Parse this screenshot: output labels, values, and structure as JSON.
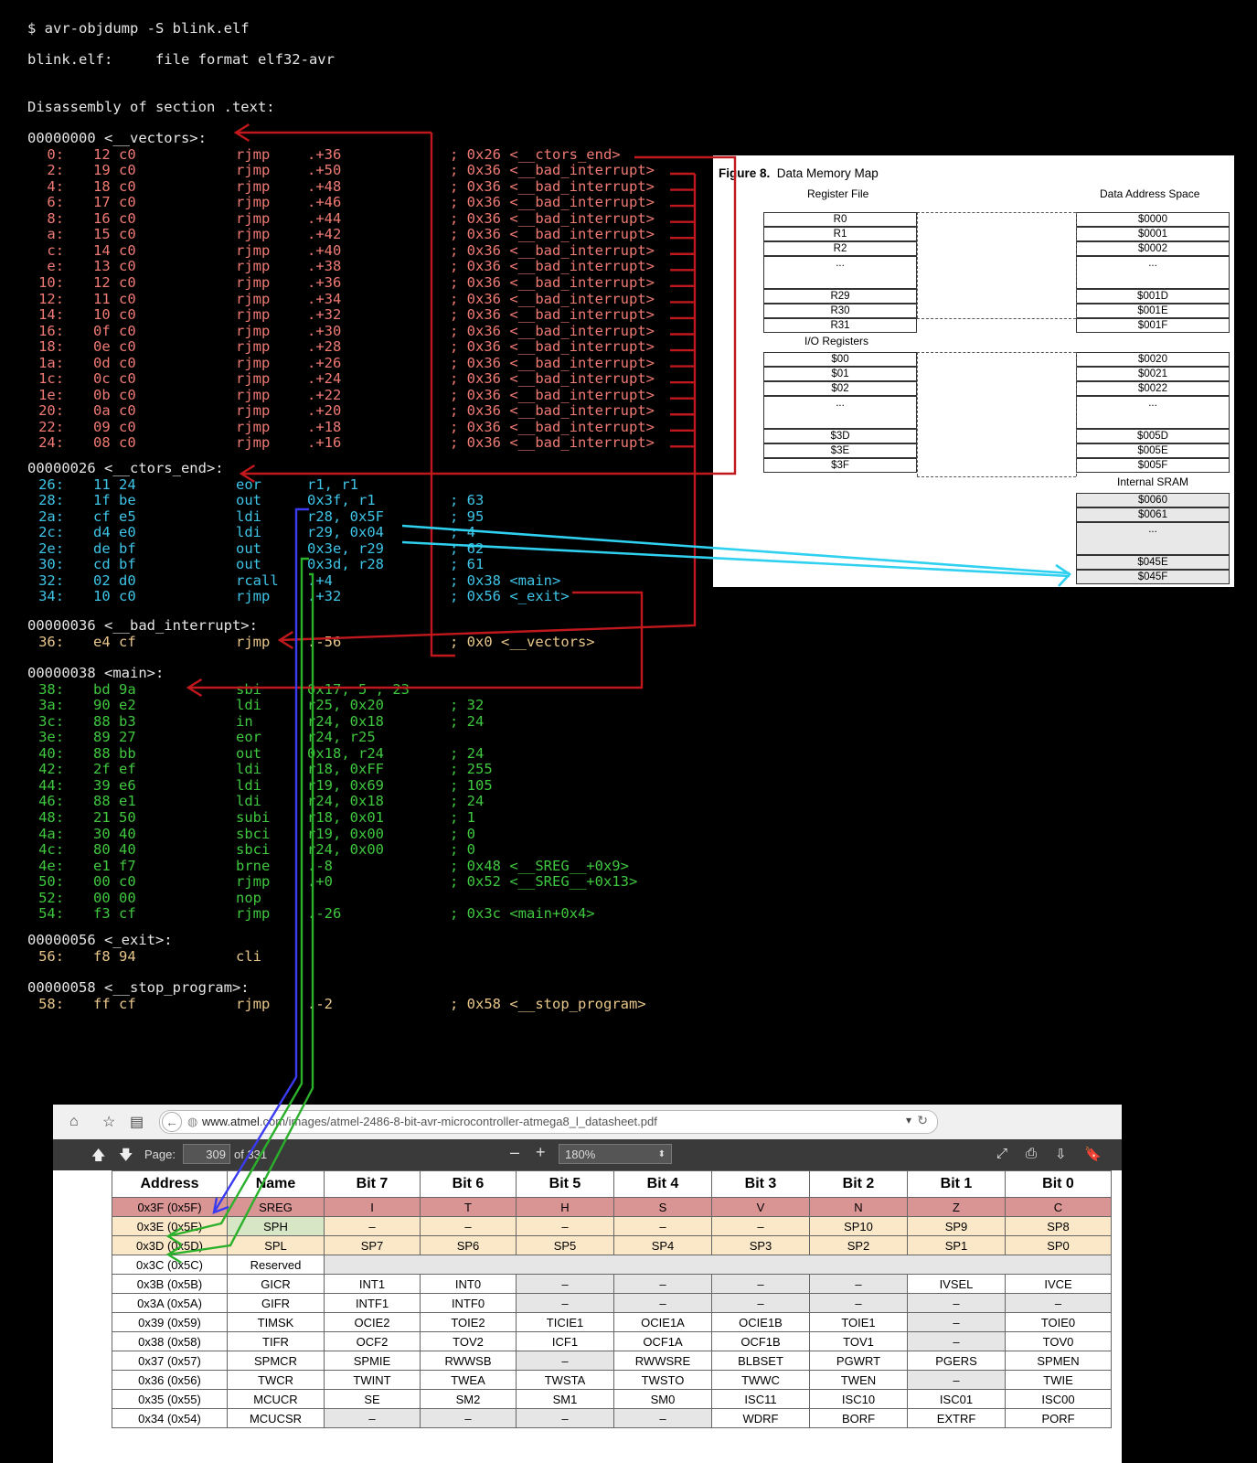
{
  "terminal": {
    "command": "$ avr-objdump -S blink.elf",
    "file_line": "blink.elf:     file format elf32-avr",
    "section": "Disassembly of section .text:",
    "vectors_label": "00000000 <__vectors>:",
    "vectors": [
      [
        "0:",
        "12 c0",
        "rjmp",
        ".+36",
        "; 0x26 <__ctors_end>"
      ],
      [
        "2:",
        "19 c0",
        "rjmp",
        ".+50",
        "; 0x36 <__bad_interrupt>"
      ],
      [
        "4:",
        "18 c0",
        "rjmp",
        ".+48",
        "; 0x36 <__bad_interrupt>"
      ],
      [
        "6:",
        "17 c0",
        "rjmp",
        ".+46",
        "; 0x36 <__bad_interrupt>"
      ],
      [
        "8:",
        "16 c0",
        "rjmp",
        ".+44",
        "; 0x36 <__bad_interrupt>"
      ],
      [
        "a:",
        "15 c0",
        "rjmp",
        ".+42",
        "; 0x36 <__bad_interrupt>"
      ],
      [
        "c:",
        "14 c0",
        "rjmp",
        ".+40",
        "; 0x36 <__bad_interrupt>"
      ],
      [
        "e:",
        "13 c0",
        "rjmp",
        ".+38",
        "; 0x36 <__bad_interrupt>"
      ],
      [
        "10:",
        "12 c0",
        "rjmp",
        ".+36",
        "; 0x36 <__bad_interrupt>"
      ],
      [
        "12:",
        "11 c0",
        "rjmp",
        ".+34",
        "; 0x36 <__bad_interrupt>"
      ],
      [
        "14:",
        "10 c0",
        "rjmp",
        ".+32",
        "; 0x36 <__bad_interrupt>"
      ],
      [
        "16:",
        "0f c0",
        "rjmp",
        ".+30",
        "; 0x36 <__bad_interrupt>"
      ],
      [
        "18:",
        "0e c0",
        "rjmp",
        ".+28",
        "; 0x36 <__bad_interrupt>"
      ],
      [
        "1a:",
        "0d c0",
        "rjmp",
        ".+26",
        "; 0x36 <__bad_interrupt>"
      ],
      [
        "1c:",
        "0c c0",
        "rjmp",
        ".+24",
        "; 0x36 <__bad_interrupt>"
      ],
      [
        "1e:",
        "0b c0",
        "rjmp",
        ".+22",
        "; 0x36 <__bad_interrupt>"
      ],
      [
        "20:",
        "0a c0",
        "rjmp",
        ".+20",
        "; 0x36 <__bad_interrupt>"
      ],
      [
        "22:",
        "09 c0",
        "rjmp",
        ".+18",
        "; 0x36 <__bad_interrupt>"
      ],
      [
        "24:",
        "08 c0",
        "rjmp",
        ".+16",
        "; 0x36 <__bad_interrupt>"
      ]
    ],
    "ctors_label": "00000026 <__ctors_end>:",
    "ctors": [
      [
        "26:",
        "11 24",
        "eor",
        "r1, r1",
        ""
      ],
      [
        "28:",
        "1f be",
        "out",
        "0x3f, r1",
        "; 63"
      ],
      [
        "2a:",
        "cf e5",
        "ldi",
        "r28, 0x5F",
        "; 95"
      ],
      [
        "2c:",
        "d4 e0",
        "ldi",
        "r29, 0x04",
        "; 4"
      ],
      [
        "2e:",
        "de bf",
        "out",
        "0x3e, r29",
        "; 62"
      ],
      [
        "30:",
        "cd bf",
        "out",
        "0x3d, r28",
        "; 61"
      ],
      [
        "32:",
        "02 d0",
        "rcall",
        ".+4",
        "; 0x38 <main>"
      ],
      [
        "34:",
        "10 c0",
        "rjmp",
        ".+32",
        "; 0x56 <_exit>"
      ]
    ],
    "bad_label": "00000036 <__bad_interrupt>:",
    "bad": [
      [
        "36:",
        "e4 cf",
        "rjmp",
        ".-56",
        "; 0x0 <__vectors>"
      ]
    ],
    "main_label": "00000038 <main>:",
    "main": [
      [
        "38:",
        "bd 9a",
        "sbi",
        "0x17, 5 ; 23",
        ""
      ],
      [
        "3a:",
        "90 e2",
        "ldi",
        "r25, 0x20",
        "; 32"
      ],
      [
        "3c:",
        "88 b3",
        "in",
        "r24, 0x18",
        "; 24"
      ],
      [
        "3e:",
        "89 27",
        "eor",
        "r24, r25",
        ""
      ],
      [
        "40:",
        "88 bb",
        "out",
        "0x18, r24",
        "; 24"
      ],
      [
        "42:",
        "2f ef",
        "ldi",
        "r18, 0xFF",
        "; 255"
      ],
      [
        "44:",
        "39 e6",
        "ldi",
        "r19, 0x69",
        "; 105"
      ],
      [
        "46:",
        "88 e1",
        "ldi",
        "r24, 0x18",
        "; 24"
      ],
      [
        "48:",
        "21 50",
        "subi",
        "r18, 0x01",
        "; 1"
      ],
      [
        "4a:",
        "30 40",
        "sbci",
        "r19, 0x00",
        "; 0"
      ],
      [
        "4c:",
        "80 40",
        "sbci",
        "r24, 0x00",
        "; 0"
      ],
      [
        "4e:",
        "e1 f7",
        "brne",
        ".-8",
        "; 0x48 <__SREG__+0x9>"
      ],
      [
        "50:",
        "00 c0",
        "rjmp",
        ".+0",
        "; 0x52 <__SREG__+0x13>"
      ],
      [
        "52:",
        "00 00",
        "nop",
        "",
        ""
      ],
      [
        "54:",
        "f3 cf",
        "rjmp",
        ".-26",
        "; 0x3c <main+0x4>"
      ]
    ],
    "exit_label": "00000056 <_exit>:",
    "exit": [
      [
        "56:",
        "f8 94",
        "cli",
        "",
        ""
      ]
    ],
    "stop_label": "00000058 <__stop_program>:",
    "stop": [
      [
        "58:",
        "ff cf",
        "rjmp",
        ".-2",
        "; 0x58 <__stop_program>"
      ]
    ]
  },
  "figure": {
    "title_bold": "Figure 8.",
    "title": "Data Memory Map",
    "register_file": "Register File",
    "data_space": "Data Address Space",
    "io_registers": "I/O Registers",
    "internal_sram": "Internal SRAM",
    "regs": [
      "R0",
      "R1",
      "R2",
      "...",
      "R29",
      "R30",
      "R31"
    ],
    "reg_addrs": [
      "$0000",
      "$0001",
      "$0002",
      "...",
      "$001D",
      "$001E",
      "$001F"
    ],
    "io": [
      "$00",
      "$01",
      "$02",
      "...",
      "$3D",
      "$3E",
      "$3F"
    ],
    "io_addrs": [
      "$0020",
      "$0021",
      "$0022",
      "...",
      "$005D",
      "$005E",
      "$005F"
    ],
    "sram": [
      "$0060",
      "$0061",
      "...",
      "$045E",
      "$045F"
    ]
  },
  "browser": {
    "url_prefix": "www.atmel",
    "url_rest": ".com/images/atmel-2486-8-bit-avr-microcontroller-atmega8_l_datasheet.pdf",
    "page_label": "Page:",
    "page_value": "309",
    "page_of": "of 331",
    "zoom": "180%",
    "minus": "–",
    "plus": "+",
    "columns": [
      "Address",
      "Name",
      "Bit 7",
      "Bit 6",
      "Bit 5",
      "Bit 4",
      "Bit 3",
      "Bit 2",
      "Bit 1",
      "Bit 0"
    ],
    "rows": [
      [
        "0x3F (0x5F)",
        "SREG",
        "I",
        "T",
        "H",
        "S",
        "V",
        "N",
        "Z",
        "C"
      ],
      [
        "0x3E (0x5E)",
        "SPH",
        "–",
        "–",
        "–",
        "–",
        "–",
        "SP10",
        "SP9",
        "SP8"
      ],
      [
        "0x3D (0x5D)",
        "SPL",
        "SP7",
        "SP6",
        "SP5",
        "SP4",
        "SP3",
        "SP2",
        "SP1",
        "SP0"
      ],
      [
        "0x3C (0x5C)",
        "Reserved",
        "",
        "",
        "",
        "",
        "",
        "",
        "",
        ""
      ],
      [
        "0x3B (0x5B)",
        "GICR",
        "INT1",
        "INT0",
        "–",
        "–",
        "–",
        "–",
        "IVSEL",
        "IVCE"
      ],
      [
        "0x3A (0x5A)",
        "GIFR",
        "INTF1",
        "INTF0",
        "–",
        "–",
        "–",
        "–",
        "–",
        "–"
      ],
      [
        "0x39 (0x59)",
        "TIMSK",
        "OCIE2",
        "TOIE2",
        "TICIE1",
        "OCIE1A",
        "OCIE1B",
        "TOIE1",
        "–",
        "TOIE0"
      ],
      [
        "0x38 (0x58)",
        "TIFR",
        "OCF2",
        "TOV2",
        "ICF1",
        "OCF1A",
        "OCF1B",
        "TOV1",
        "–",
        "TOV0"
      ],
      [
        "0x37 (0x57)",
        "SPMCR",
        "SPMIE",
        "RWWSB",
        "–",
        "RWWSRE",
        "BLBSET",
        "PGWRT",
        "PGERS",
        "SPMEN"
      ],
      [
        "0x36 (0x56)",
        "TWCR",
        "TWINT",
        "TWEA",
        "TWSTA",
        "TWSTO",
        "TWWC",
        "TWEN",
        "–",
        "TWIE"
      ],
      [
        "0x35 (0x55)",
        "MCUCR",
        "SE",
        "SM2",
        "SM1",
        "SM0",
        "ISC11",
        "ISC10",
        "ISC01",
        "ISC00"
      ],
      [
        "0x34 (0x54)",
        "MCUCSR",
        "–",
        "–",
        "–",
        "–",
        "WDRF",
        "BORF",
        "EXTRF",
        "PORF"
      ]
    ]
  },
  "colors": {
    "background": "#000000",
    "vectors_text": "#f07a74",
    "ctors_text": "#3ec4e6",
    "main_text": "#3fc83f",
    "label_text": "#e8c68a",
    "arrow_red": "#c0181c",
    "arrow_blue": "#3b3bf0",
    "arrow_green": "#2ab02a",
    "arrow_cyan": "#2fd0f0",
    "sreg_row": "#d99594",
    "sp_rows": "#fbe8c8"
  }
}
